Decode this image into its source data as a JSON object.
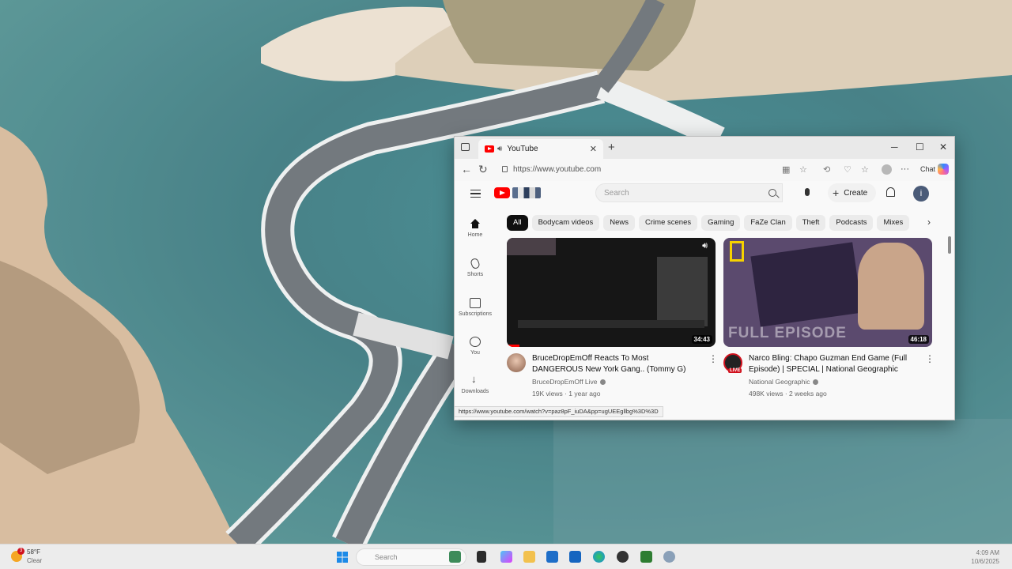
{
  "browser": {
    "tab_title": "YouTube",
    "tab_close": "✕",
    "new_tab": "+",
    "url": "https://www.youtube.com",
    "chat_label": "Chat",
    "window_controls": [
      "─",
      "☐",
      "✕"
    ]
  },
  "youtube": {
    "search_placeholder": "Search",
    "create_label": "Create",
    "avatar_letter": "i",
    "sidebar": [
      {
        "label": "Home",
        "icon": "home-icon"
      },
      {
        "label": "Shorts",
        "icon": "shorts-icon"
      },
      {
        "label": "Subscriptions",
        "icon": "subscriptions-icon"
      },
      {
        "label": "You",
        "icon": "you-icon"
      },
      {
        "label": "Downloads",
        "icon": "download-icon"
      }
    ],
    "chips": [
      "All",
      "Bodycam videos",
      "News",
      "Crime scenes",
      "Gaming",
      "FaZe Clan",
      "Theft",
      "Podcasts",
      "Mixes"
    ],
    "videos": [
      {
        "title": "BruceDropEmOff Reacts To Most DANGEROUS New York Gang.. (Tommy G)",
        "channel": "BruceDropEmOff Live",
        "meta": "19K views · 1 year ago",
        "duration": "34:43"
      },
      {
        "title": "Narco Bling: Chapo Guzman End Game (Full Episode) | SPECIAL | National Geographic",
        "channel": "National Geographic",
        "meta": "498K views · 2 weeks ago",
        "duration": "46:18",
        "thumb_text": "FULL EPISODE",
        "live_badge": "LIVE"
      }
    ],
    "status_url": "https://www.youtube.com/watch?v=paz8pF_iuDA&pp=ugUEEgllbg%3D%3D"
  },
  "taskbar": {
    "weather_temp": "58°F",
    "weather_condition": "Clear",
    "weather_badge": "3",
    "search_placeholder": "Search",
    "time": "4:09 AM",
    "date": "10/6/2025"
  },
  "colors": {
    "yt_red": "#ff0000",
    "accent_blue": "#1b8ae8"
  }
}
